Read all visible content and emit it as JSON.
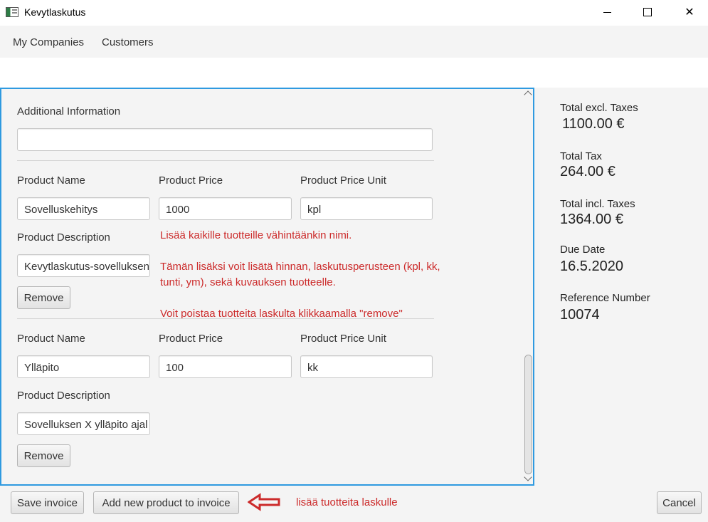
{
  "window": {
    "title": "Kevytlaskutus",
    "minimize_icon": "minimize-icon",
    "maximize_icon": "maximize-icon",
    "close_icon": "close-icon"
  },
  "menu": {
    "items": [
      {
        "label": "My Companies"
      },
      {
        "label": "Customers"
      }
    ]
  },
  "form": {
    "additional_info_label": "Additional Information",
    "additional_info_value": "",
    "products": [
      {
        "name_label": "Product Name",
        "price_label": "Product Price",
        "unit_label": "Product Price Unit",
        "description_label": "Product Description",
        "name": "Sovelluskehitys",
        "price": "1000",
        "unit": "kpl",
        "description": "Kevytlaskutus-sovelluksen",
        "remove_label": "Remove"
      },
      {
        "name_label": "Product Name",
        "price_label": "Product Price",
        "unit_label": "Product Price Unit",
        "description_label": "Product Description",
        "name": "Ylläpito",
        "price": "100",
        "unit": "kk",
        "description": "Sovelluksen X ylläpito ajal",
        "remove_label": "Remove"
      }
    ]
  },
  "annotations": {
    "line1": "Lisää kaikille tuotteille vähintäänkin nimi.",
    "line2a": "Tämän lisäksi voit lisätä hinnan, laskutusperusteen (kpl, kk,",
    "line2b": "tunti, ym), sekä kuvauksen tuotteelle.",
    "line3": "Voit poistaa tuotteita laskulta klikkaamalla \"remove\"",
    "bottom": "lisää tuotteita laskulle",
    "arrow_icon": "red-left-arrow-icon",
    "color": "#cc2b2b"
  },
  "summary": {
    "total_excl_label": "Total excl. Taxes",
    "total_excl_value": "1100.00 €",
    "total_tax_label": "Total Tax",
    "total_tax_value": "264.00 €",
    "total_incl_label": "Total incl. Taxes",
    "total_incl_value": "1364.00 €",
    "due_date_label": "Due Date",
    "due_date_value": "16.5.2020",
    "reference_label": "Reference Number",
    "reference_value": "10074"
  },
  "actions": {
    "save_label": "Save invoice",
    "add_product_label": "Add new product to invoice",
    "cancel_label": "Cancel"
  },
  "colors": {
    "focus_border": "#2f9ae0",
    "panel_bg": "#f4f4f4",
    "annotation_red": "#cc2b2b"
  }
}
